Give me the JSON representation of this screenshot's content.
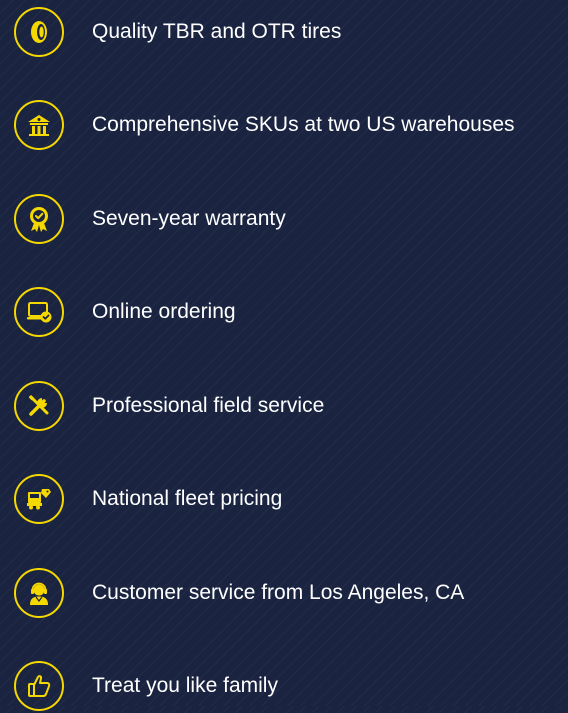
{
  "colors": {
    "background": "#1a2440",
    "accent": "#f5d800",
    "text": "#ffffff"
  },
  "features": [
    {
      "label": "Quality TBR and OTR tires",
      "icon": "tire-icon"
    },
    {
      "label": "Comprehensive SKUs at two US warehouses",
      "icon": "warehouse-icon"
    },
    {
      "label": "Seven-year warranty",
      "icon": "warranty-badge-icon"
    },
    {
      "label": "Online ordering",
      "icon": "laptop-check-icon"
    },
    {
      "label": "Professional field service",
      "icon": "tools-icon"
    },
    {
      "label": "National fleet pricing",
      "icon": "fleet-truck-icon"
    },
    {
      "label": "Customer service from Los Angeles, CA",
      "icon": "customer-support-icon"
    },
    {
      "label": "Treat you like family",
      "icon": "thumbs-up-icon"
    }
  ]
}
